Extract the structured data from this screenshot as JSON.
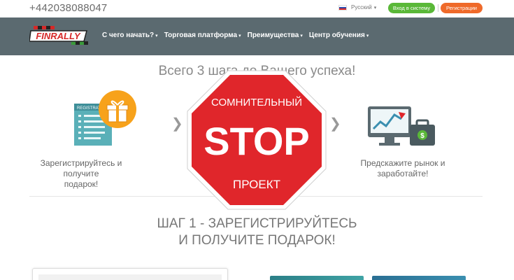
{
  "topbar": {
    "phone": "+442038088047",
    "language": "Русский",
    "login_label": "Вход в систему",
    "register_label": "Регистрации"
  },
  "nav": {
    "logo_text": "FINRALLY",
    "items": [
      {
        "label": "С чего начать?"
      },
      {
        "label": "Торговая платформа"
      },
      {
        "label": "Преимущества"
      },
      {
        "label": "Центр обучения"
      }
    ]
  },
  "hero": {
    "title": "Всего 3 шага до Вашего успеха!"
  },
  "steps": [
    {
      "caption_line1": "Зарегистрируйтесь и получите",
      "caption_line2": "подарок!",
      "icon_text": "REGISTRATION"
    },
    {
      "caption_line1": "Предскажите рынок и",
      "caption_line2": "заработайте!"
    }
  ],
  "step_heading": {
    "line1": "ШАГ 1 - ЗАРЕГИСТРИРУЙТЕСЬ",
    "line2": "И ПОЛУЧИТЕ ПОДАРОК!"
  },
  "stop_sign": {
    "top": "СОМНИТЕЛЬНЫЙ",
    "main": "STOP",
    "bottom": "ПРОЕКТ"
  },
  "colors": {
    "nav_bg": "#5b6a70",
    "login_btn": "#5ab838",
    "register_btn": "#ef6a2a",
    "stop_red": "#e0262b"
  }
}
